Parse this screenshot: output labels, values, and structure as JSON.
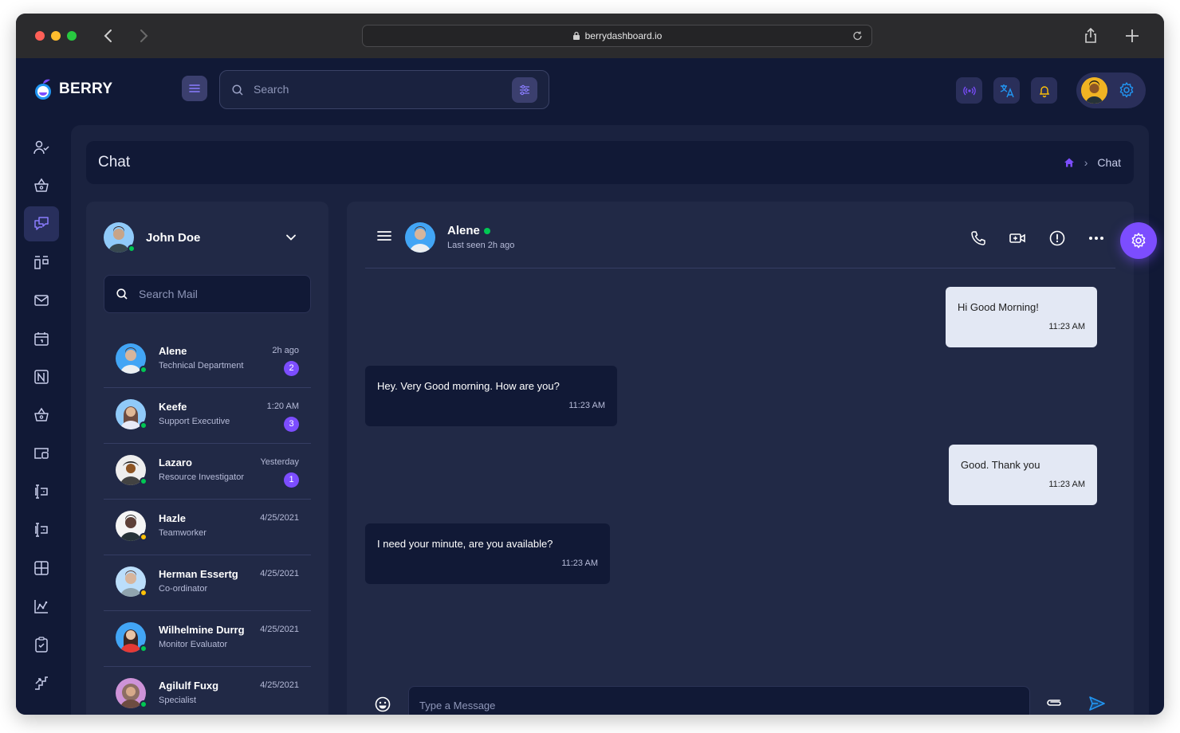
{
  "browser": {
    "url": "berrydashboard.io"
  },
  "app": {
    "brand": "BERRY",
    "search_placeholder": "Search",
    "accent_color": "#7c4dff",
    "background_color": "#111936"
  },
  "rail_icons": [
    "user-check-icon",
    "basket-icon",
    "chat-icon",
    "kanban-icon",
    "mail-icon",
    "calendar-icon",
    "notion-icon",
    "basket-icon",
    "wallet-icon",
    "forms-icon",
    "forms-icon",
    "table-icon",
    "chart-icon",
    "clipboard-icon",
    "stairs-icon",
    "brush-icon"
  ],
  "page": {
    "title": "Chat",
    "breadcrumb_current": "Chat"
  },
  "user": {
    "name": "John Doe"
  },
  "contacts_search_placeholder": "Search Mail",
  "contacts": [
    {
      "name": "Alene",
      "role": "Technical Department",
      "time": "2h ago",
      "badge": "2",
      "status": "online"
    },
    {
      "name": "Keefe",
      "role": "Support Executive",
      "time": "1:20 AM",
      "badge": "3",
      "status": "online"
    },
    {
      "name": "Lazaro",
      "role": "Resource Investigator",
      "time": "Yesterday",
      "badge": "1",
      "status": "online"
    },
    {
      "name": "Hazle",
      "role": "Teamworker",
      "time": "4/25/2021",
      "badge": "",
      "status": "away"
    },
    {
      "name": "Herman Essertg",
      "role": "Co-ordinator",
      "time": "4/25/2021",
      "badge": "",
      "status": "away"
    },
    {
      "name": "Wilhelmine Durrg",
      "role": "Monitor Evaluator",
      "time": "4/25/2021",
      "badge": "",
      "status": "online"
    },
    {
      "name": "Agilulf Fuxg",
      "role": "Specialist",
      "time": "4/25/2021",
      "badge": "",
      "status": "online"
    }
  ],
  "chat": {
    "partner_name": "Alene",
    "partner_last_seen": "Last seen 2h ago",
    "messages": [
      {
        "direction": "out",
        "text": "Hi Good Morning!",
        "time": "11:23 AM"
      },
      {
        "direction": "in",
        "text": "Hey. Very Good morning. How are you?",
        "time": "11:23 AM"
      },
      {
        "direction": "out",
        "text": "Good. Thank you",
        "time": "11:23 AM"
      },
      {
        "direction": "in",
        "text": "I need your minute, are you available?",
        "time": "11:23 AM"
      }
    ],
    "composer_placeholder": "Type a Message"
  }
}
